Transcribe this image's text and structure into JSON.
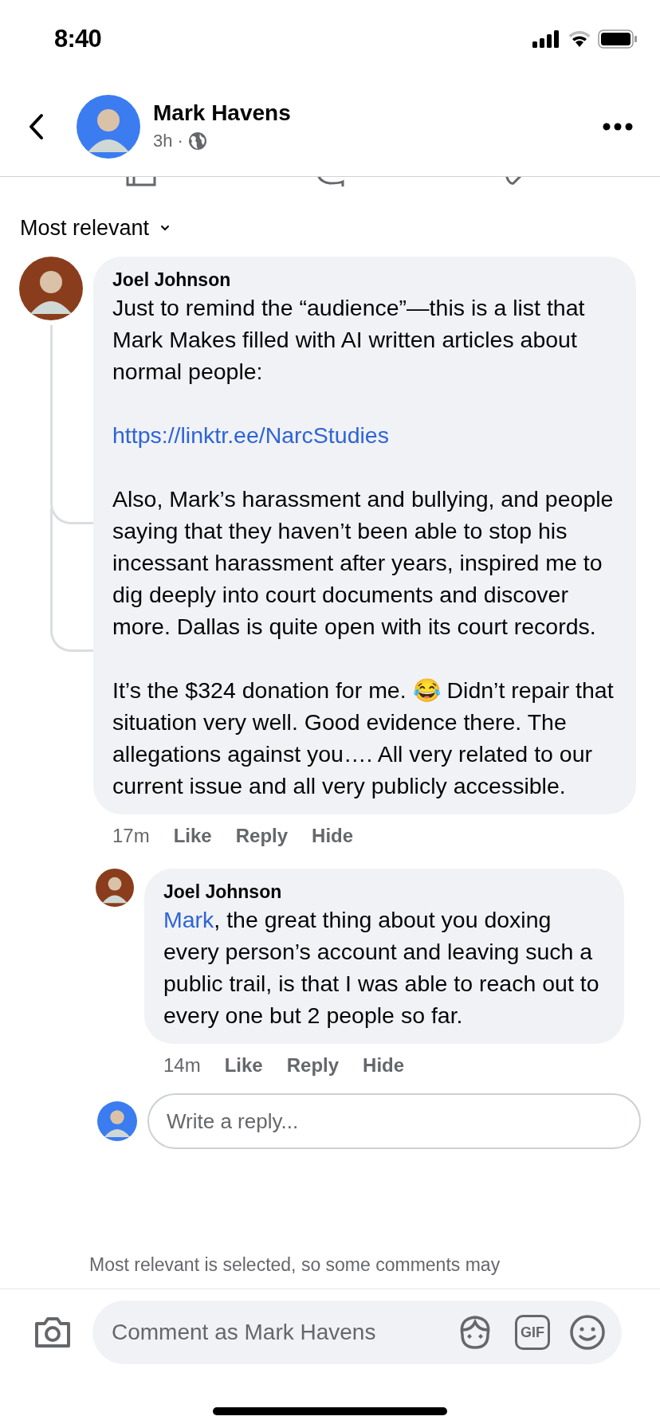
{
  "status_bar": {
    "time": "8:40"
  },
  "header": {
    "author": "Mark Havens",
    "time": "3h",
    "separator": "·"
  },
  "sort": {
    "label": "Most relevant"
  },
  "comments": [
    {
      "author": "Joel Johnson",
      "paragraphs": [
        {
          "kind": "text",
          "text": "Just to remind the “audience”—this is a list that Mark Makes filled with AI written articles about normal people:"
        },
        {
          "kind": "link",
          "text": "https://linktr.ee/NarcStudies"
        },
        {
          "kind": "text",
          "text": "Also, Mark’s harassment and bullying, and people saying that they haven’t been able to stop his incessant harassment after years, inspired me to dig deeply into court documents and discover more. Dallas is quite open with its court records."
        },
        {
          "kind": "text",
          "text": "It’s the $324 donation for me. 😂 Didn’t repair that situation very well. Good evidence there. The allegations against you…. All very related to our current issue and all very publicly accessible."
        }
      ],
      "time": "17m",
      "actions": [
        "Like",
        "Reply",
        "Hide"
      ],
      "replies": [
        {
          "author": "Joel Johnson",
          "mention": "Mark",
          "text": ", the great thing about you doxing every person’s account and leaving such a public trail, is that I was able to reach out to every one but 2 people so far.",
          "time": "14m",
          "actions": [
            "Like",
            "Reply",
            "Hide"
          ]
        }
      ]
    }
  ],
  "reply_box": {
    "placeholder": "Write a reply..."
  },
  "filter_note": "Most relevant is selected, so some comments may",
  "composer": {
    "placeholder": "Comment as Mark Havens",
    "gif_label": "GIF"
  }
}
